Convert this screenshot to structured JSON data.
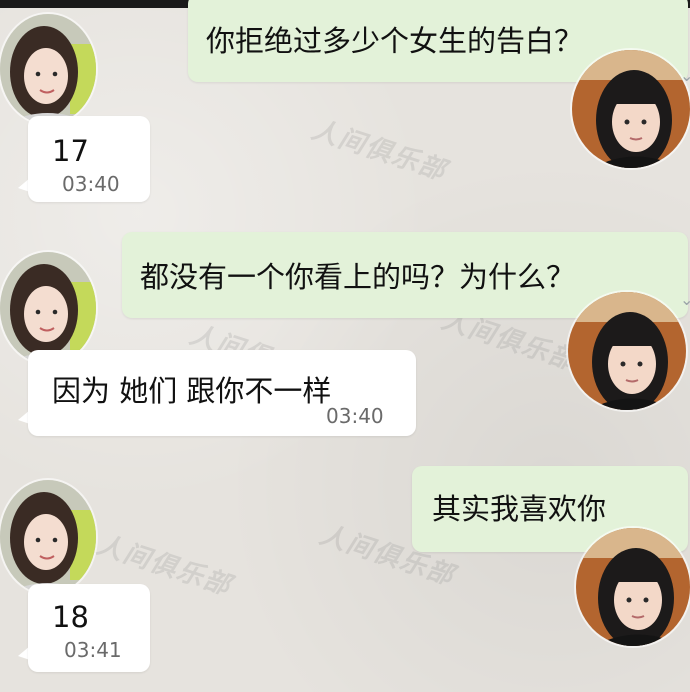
{
  "messages": [
    {
      "side": "out",
      "text": "你拒绝过多少个女生的告白？"
    },
    {
      "side": "in",
      "text": "17",
      "time": "03:40"
    },
    {
      "side": "out",
      "text": "都没有一个你看上的吗？为什么？"
    },
    {
      "side": "in",
      "text": "因为 她们 跟你不一样",
      "time": "03:40"
    },
    {
      "side": "out",
      "text": "其实我喜欢你"
    },
    {
      "side": "in",
      "text": "18",
      "time": "03:41"
    }
  ],
  "watermark": {
    "text": "人间俱乐部"
  },
  "colors": {
    "incoming_bubble": "#ffffff",
    "outgoing_bubble": "#e3f2d9",
    "background": "#e6e3de"
  },
  "icons": {
    "incoming_avatar": "woman-avatar-icon",
    "outgoing_avatar": "girl-avatar-icon"
  }
}
